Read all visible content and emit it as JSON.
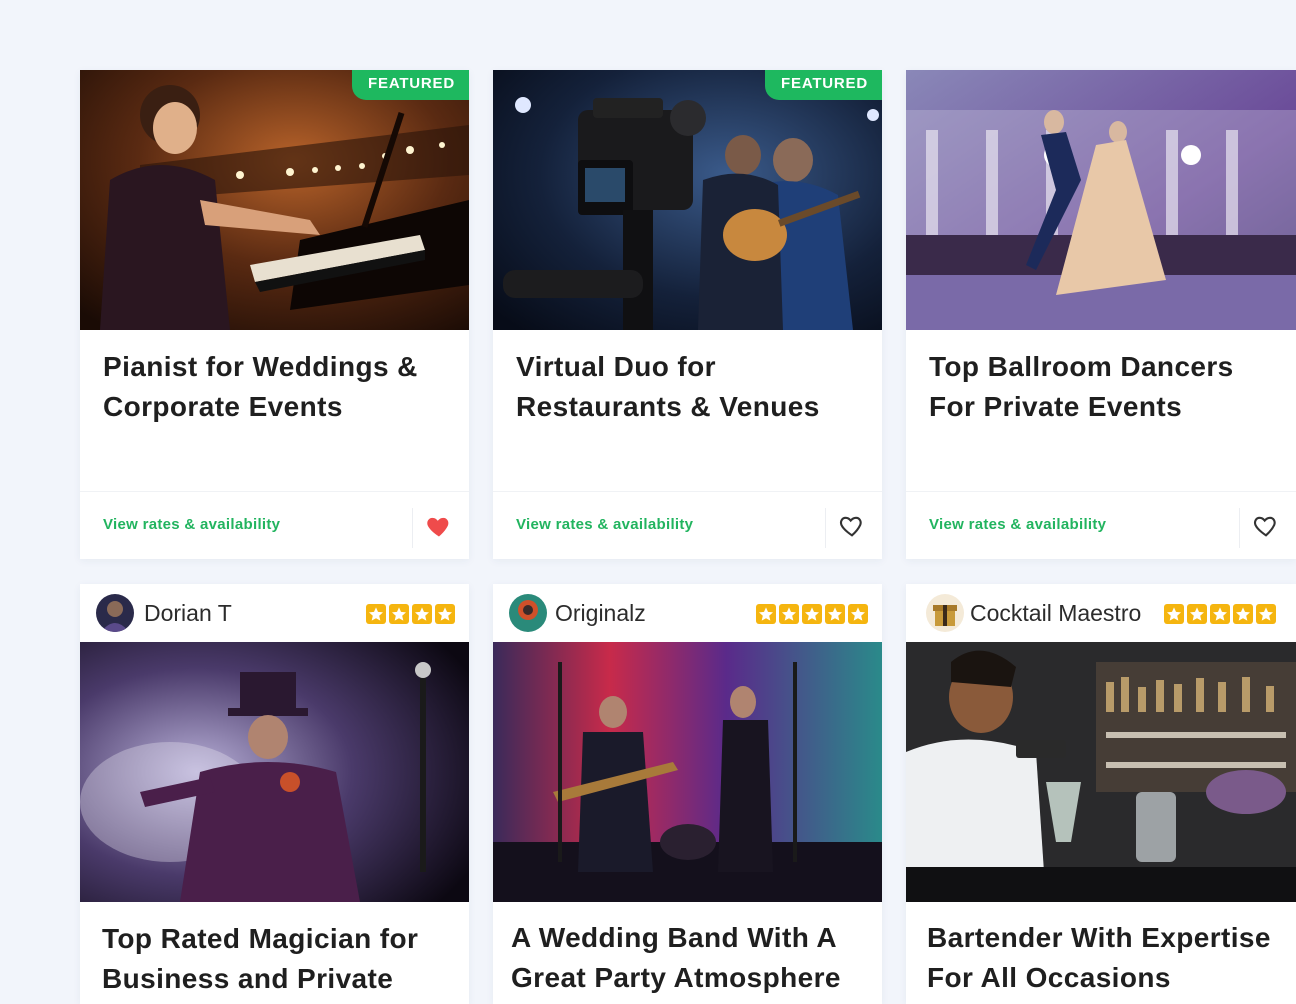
{
  "colors": {
    "page_background": "#f2f5fb",
    "accent_green": "#1eb85f",
    "heart_red": "#ef4b4b",
    "star_gold": "#f5b50f"
  },
  "cards": [
    {
      "badge": "FEATURED",
      "title": "Pianist for Weddings & Corporate Events",
      "link": "View rates & availability",
      "favorited": true,
      "photo": "pianist-photo"
    },
    {
      "badge": "FEATURED",
      "title": "Virtual Duo for Restaurants & Venues",
      "link": "View rates & availability",
      "favorited": false,
      "photo": "camera-duo-photo"
    },
    {
      "title": "Top Ballroom Dancers For Private Events",
      "link": "View rates & availability",
      "favorited": false,
      "photo": "ballroom-dancers-photo"
    },
    {
      "author": "Dorian T",
      "rating_stars": 4,
      "title": "Top Rated Magician for Business and Private",
      "photo": "magician-photo"
    },
    {
      "author": "Originalz",
      "rating_stars": 5,
      "title": "A Wedding Band With A Great Party Atmosphere",
      "photo": "wedding-band-photo"
    },
    {
      "author": "Cocktail Maestro",
      "rating_stars": 5,
      "title": "Bartender With Expertise For All Occasions",
      "photo": "bartender-photo"
    }
  ]
}
